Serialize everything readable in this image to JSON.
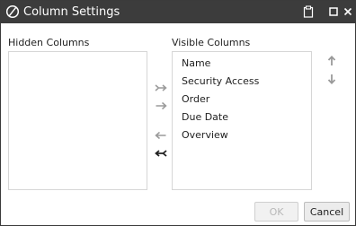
{
  "window": {
    "title": "Column Settings"
  },
  "hidden_columns": {
    "label": "Hidden Columns",
    "items": []
  },
  "visible_columns": {
    "label": "Visible Columns",
    "items": [
      "Name",
      "Security Access",
      "Order",
      "Due Date",
      "Overview"
    ]
  },
  "buttons": {
    "ok": "OK",
    "cancel": "Cancel"
  },
  "icons": {
    "app": "no-entry-circle-icon",
    "clipboard": "clipboard-icon",
    "maximize": "maximize-icon",
    "close": "close-icon",
    "move_all_right": "double-arrow-right-icon",
    "move_right": "arrow-right-icon",
    "move_left": "arrow-left-icon",
    "move_all_left": "double-arrow-left-icon",
    "move_up": "arrow-up-icon",
    "move_down": "arrow-down-icon"
  },
  "colors": {
    "titlebar": "#3c3c3c",
    "arrow_disabled": "#9a9a9a",
    "arrow_enabled": "#333333"
  }
}
